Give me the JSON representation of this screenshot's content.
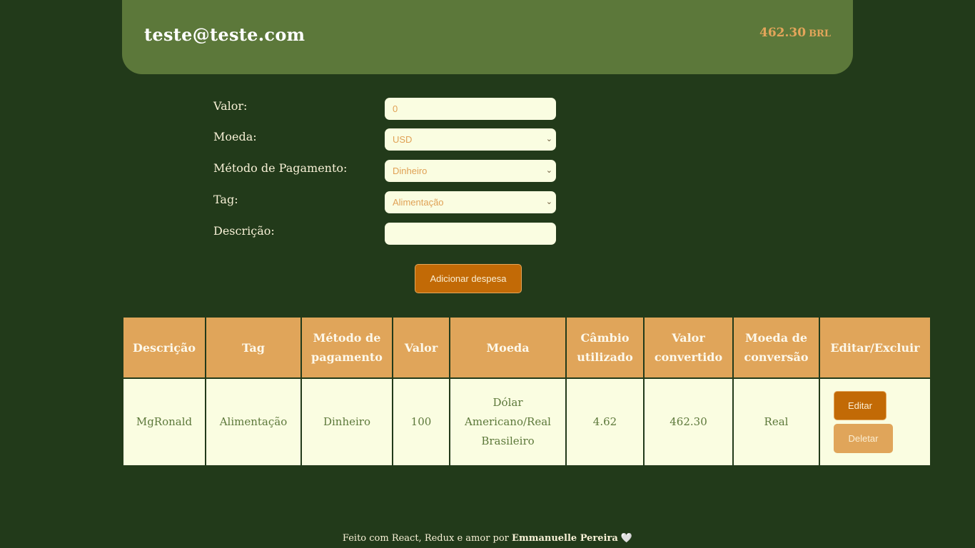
{
  "header": {
    "email": "teste@teste.com",
    "total": "462.30",
    "currency": "BRL"
  },
  "form": {
    "valor_label": "Valor:",
    "valor_value": "0",
    "moeda_label": "Moeda:",
    "moeda_value": "USD",
    "metodo_label": "Método de Pagamento:",
    "metodo_value": "Dinheiro",
    "tag_label": "Tag:",
    "tag_value": "Alimentação",
    "descricao_label": "Descrição:",
    "descricao_value": "",
    "submit_label": "Adicionar despesa"
  },
  "table": {
    "headers": [
      "Descrição",
      "Tag",
      "Método de pagamento",
      "Valor",
      "Moeda",
      "Câmbio utilizado",
      "Valor convertido",
      "Moeda de conversão",
      "Editar/Excluir"
    ],
    "rows": [
      {
        "descricao": "MgRonald",
        "tag": "Alimentação",
        "metodo": "Dinheiro",
        "valor": "100",
        "moeda": "Dólar Americano/Real Brasileiro",
        "cambio": "4.62",
        "convertido": "462.30",
        "moeda_conversao": "Real",
        "edit_label": "Editar",
        "delete_label": "Deletar"
      }
    ]
  },
  "footer": {
    "prefix": "Feito com React, Redux e amor por ",
    "author": "Emmanuelle Pereira",
    "heart": "🤍"
  },
  "colors": {
    "background": "#223a1a",
    "header": "#5c783a",
    "accent": "#c26a06",
    "accent_light": "#e0a55a",
    "cream": "#fafde1"
  }
}
